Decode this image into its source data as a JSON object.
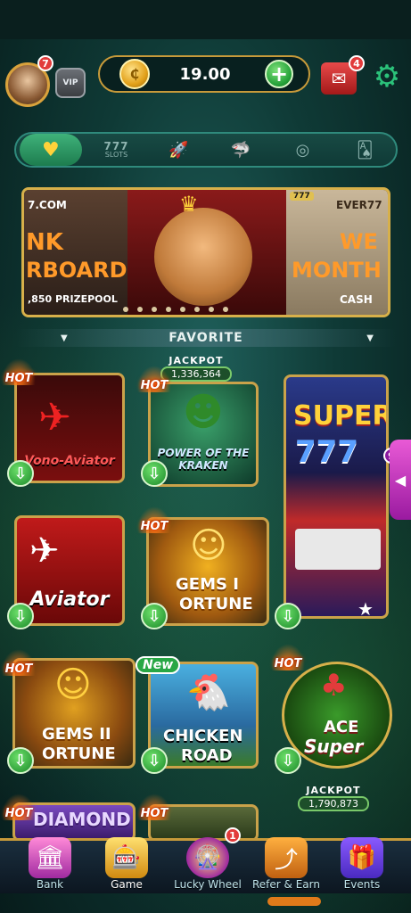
{
  "header": {
    "avatar_badge": "7",
    "vip_label": "VIP",
    "balance": "19.00",
    "coin_symbol": "₵",
    "plus_symbol": "+",
    "mail_badge": "4"
  },
  "categories": [
    {
      "icon": "heart-icon",
      "glyph": "♥",
      "active": true
    },
    {
      "icon": "slots-icon",
      "big": "777",
      "small": "SLOTS"
    },
    {
      "icon": "rocket-icon",
      "glyph": "🚀"
    },
    {
      "icon": "shark-icon",
      "glyph": "🦈"
    },
    {
      "icon": "roulette-icon",
      "glyph": "◎"
    },
    {
      "icon": "cards-icon",
      "glyph": "🂡"
    }
  ],
  "banner": {
    "left_top": "7.COM",
    "left_big1": "NK",
    "left_big2": "RBOARD",
    "left_small": ",850 PRIZEPOOL",
    "right_top": "EVER77",
    "right_badge": "777",
    "right_big1": "WE",
    "right_big2": "MONTH",
    "right_small": "CASH"
  },
  "section": {
    "title": "FAVORITE"
  },
  "games": [
    {
      "name": "Vono-Aviator",
      "tag": "HOT"
    },
    {
      "name": "POWER OF THE KRAKEN",
      "tag": "HOT",
      "jackpot_label": "JACKPOT",
      "jackpot_value": "1,336,364"
    },
    {
      "name": "SUPER 777",
      "line1": "SUPER",
      "line2": "777",
      "side_badge": "9"
    },
    {
      "name": "Aviator"
    },
    {
      "name": "GEMS FORTUNE",
      "line1": "GEMS I",
      "line2": "ORTUNE",
      "tag": "HOT"
    },
    {
      "name": "GEMS FORTUNE II",
      "line1": "GEMS II",
      "line2": "ORTUNE",
      "tag": "HOT"
    },
    {
      "name": "CHICKEN ROAD",
      "line1": "CHICKEN",
      "line2": "ROAD",
      "tag": "New"
    },
    {
      "name": "ACE SUPER",
      "line1": "ACE",
      "line2": "Super",
      "tag": "HOT"
    },
    {
      "name": "DIAMOND",
      "tag": "HOT"
    },
    {
      "tag": "HOT"
    },
    {
      "jackpot_label": "JACKPOT",
      "jackpot_value": "1,790,873"
    }
  ],
  "bottom_nav": [
    {
      "label": "Bank",
      "icon": "bank-icon"
    },
    {
      "label": "Game",
      "icon": "slot-machine-icon",
      "active": true
    },
    {
      "label": "Lucky Wheel",
      "icon": "wheel-icon",
      "badge": "1"
    },
    {
      "label": "Refer & Earn",
      "icon": "share-icon"
    },
    {
      "label": "Events",
      "icon": "gift-icon"
    }
  ]
}
